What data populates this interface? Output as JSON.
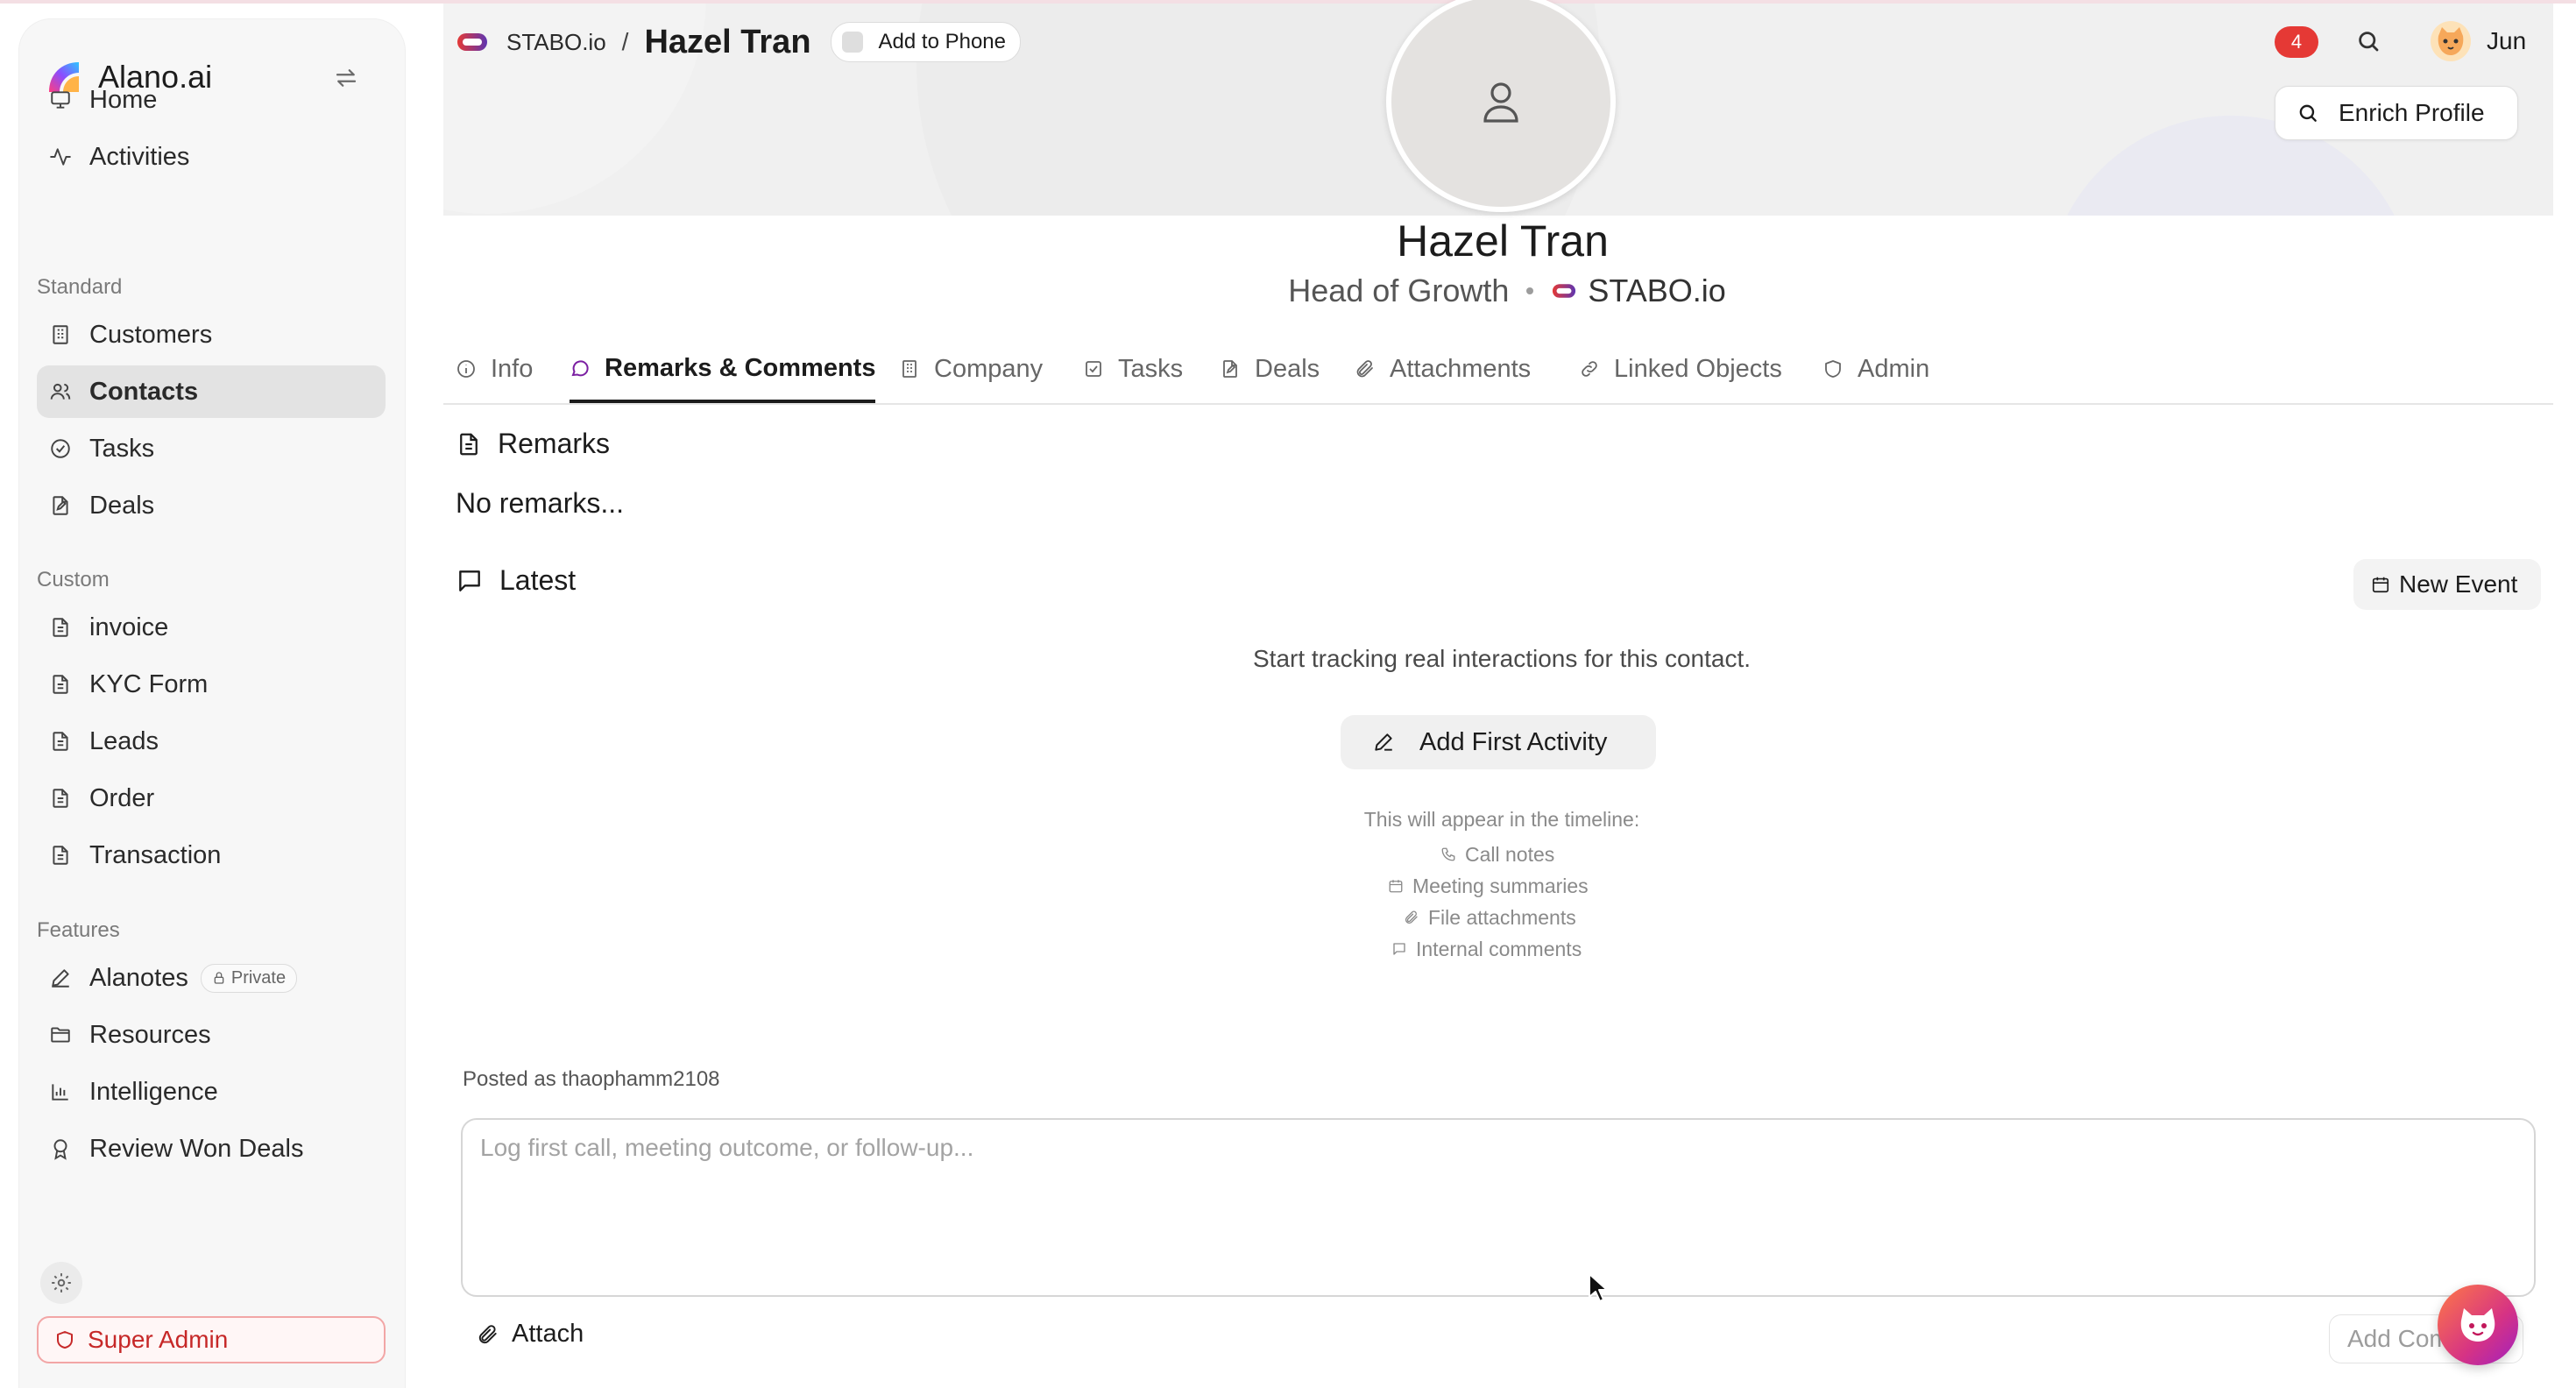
{
  "app": {
    "name": "Alano.ai",
    "brand_color": "#7b5cff"
  },
  "sidebar": {
    "primary": [
      {
        "label": "Home",
        "icon": "monitor-icon"
      },
      {
        "label": "Activities",
        "icon": "activity-icon"
      }
    ],
    "sections": {
      "standard": "Standard",
      "custom": "Custom",
      "features": "Features"
    },
    "standard_items": [
      {
        "label": "Customers",
        "icon": "building-icon"
      },
      {
        "label": "Contacts",
        "icon": "users-icon",
        "active": true
      },
      {
        "label": "Tasks",
        "icon": "check-circle-icon"
      },
      {
        "label": "Deals",
        "icon": "edit-doc-icon"
      }
    ],
    "custom_items": [
      {
        "label": "invoice",
        "icon": "file-icon"
      },
      {
        "label": "KYC Form",
        "icon": "file-icon"
      },
      {
        "label": "Leads",
        "icon": "file-icon"
      },
      {
        "label": "Order",
        "icon": "file-icon"
      },
      {
        "label": "Transaction",
        "icon": "file-icon"
      }
    ],
    "feature_items": [
      {
        "label": "Alanotes",
        "icon": "pen-icon",
        "pill": "Private"
      },
      {
        "label": "Resources",
        "icon": "folder-icon"
      },
      {
        "label": "Intelligence",
        "icon": "bar-chart-icon"
      },
      {
        "label": "Review Won Deals",
        "icon": "award-icon"
      }
    ],
    "super_admin": "Super Admin"
  },
  "header": {
    "company": "STABO.io",
    "separator": "/",
    "contact_name": "Hazel Tran",
    "add_to_phone": "Add to Phone",
    "notification_count": "4",
    "user_name": "Jun",
    "enrich_label": "Enrich Profile"
  },
  "profile": {
    "name": "Hazel Tran",
    "title": "Head of Growth",
    "company": "STABO.io"
  },
  "tabs": [
    {
      "label": "Info"
    },
    {
      "label": "Remarks & Comments",
      "active": true
    },
    {
      "label": "Company"
    },
    {
      "label": "Tasks"
    },
    {
      "label": "Deals"
    },
    {
      "label": "Attachments"
    },
    {
      "label": "Linked Objects"
    },
    {
      "label": "Admin"
    }
  ],
  "remarks": {
    "heading": "Remarks",
    "empty": "No remarks..."
  },
  "latest": {
    "heading": "Latest",
    "new_event": "New Event",
    "empty_message": "Start tracking real interactions for this contact.",
    "add_first": "Add First Activity",
    "appear_heading": "This will appear in the timeline:",
    "timeline_items": [
      "Call notes",
      "Meeting summaries",
      "File attachments",
      "Internal comments"
    ]
  },
  "composer": {
    "posted_as": "Posted as thaophamm2108",
    "placeholder": "Log first call, meeting outcome, or follow-up...",
    "attach": "Attach",
    "add_comment": "Add Comment"
  },
  "colors": {
    "accent_purple": "#7b1fa2",
    "alert_red": "#e53935",
    "super_admin_red": "#c62828"
  }
}
